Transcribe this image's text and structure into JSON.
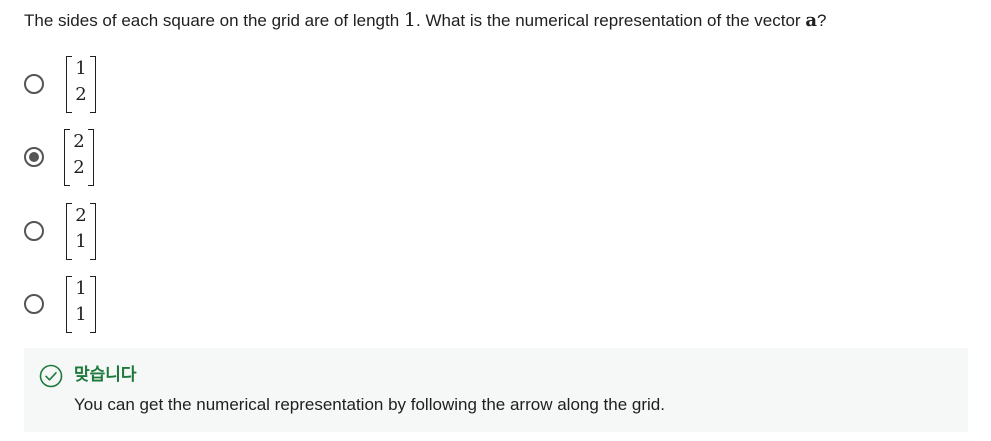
{
  "question": {
    "prefix": "The sides of each square on the grid are of length ",
    "length_value": "1",
    "middle": ". What is the numerical representation of the vector ",
    "vector_symbol": "a",
    "suffix": "?"
  },
  "options": [
    {
      "top": "1",
      "bottom": "2",
      "selected": false
    },
    {
      "top": "2",
      "bottom": "2",
      "selected": true
    },
    {
      "top": "2",
      "bottom": "1",
      "selected": false
    },
    {
      "top": "1",
      "bottom": "1",
      "selected": false
    }
  ],
  "feedback": {
    "title": "맞습니다",
    "text": "You can get the numerical representation by following the arrow along the grid.",
    "accent_color": "#1e7a3c",
    "icon": "check-circle-icon"
  }
}
